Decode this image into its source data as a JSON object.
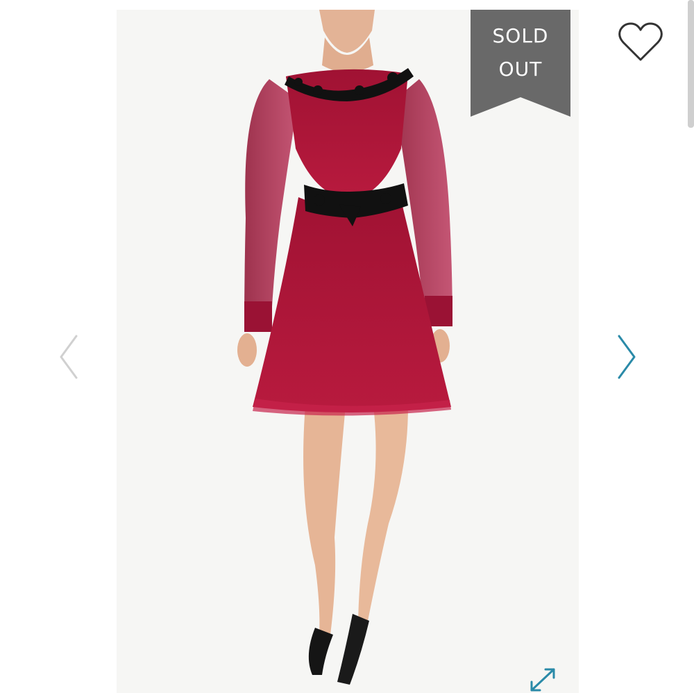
{
  "product_image": {
    "badge": {
      "line1": "SOLD",
      "line2": "OUT"
    }
  },
  "icons": {
    "wishlist": "heart-outline-icon",
    "previous": "chevron-left-icon",
    "next": "chevron-right-icon",
    "fullscreen": "expand-arrows-icon"
  },
  "colors": {
    "badge_bg": "#696969",
    "accent": "#2a8aa8",
    "arrow_inactive": "#d0d0d0",
    "dress": "#b0163a"
  }
}
